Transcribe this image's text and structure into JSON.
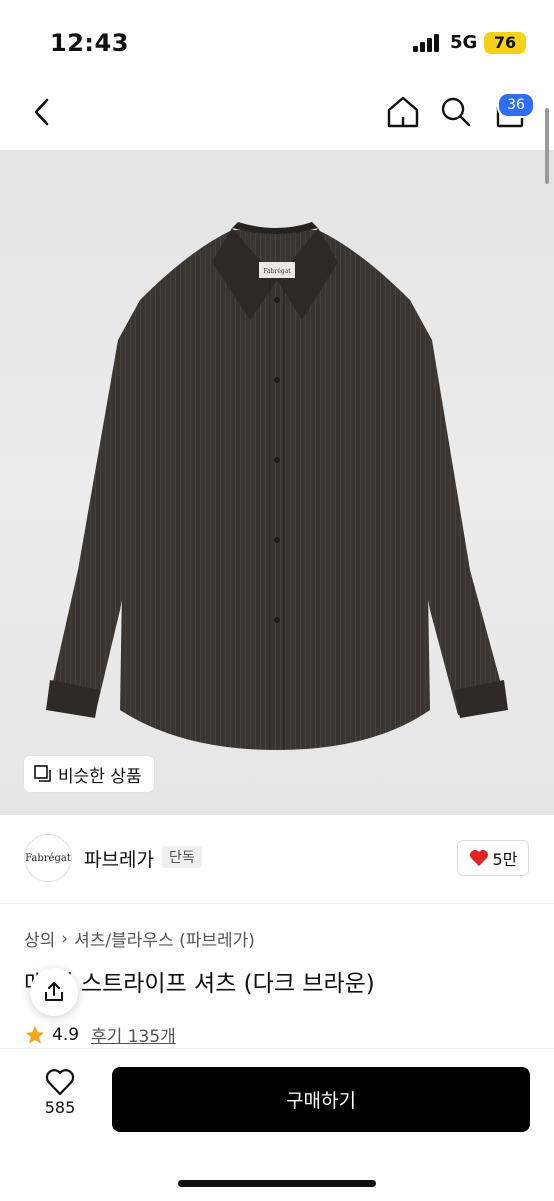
{
  "status_bar": {
    "time": "12:43",
    "network": "5G",
    "battery": "76"
  },
  "nav": {
    "cart_count": "36",
    "icons": [
      "back-icon",
      "home-icon",
      "search-icon",
      "bag-icon"
    ]
  },
  "image": {
    "similar_label": "비슷한 상품",
    "shirt_label_text": "Fabrégat"
  },
  "brand": {
    "logo_text": "Fabrégat",
    "name": "파브레가",
    "tag": "단독",
    "likes": "5만"
  },
  "breadcrumb": [
    "상의",
    "셔츠/블라우스 (파브레가)"
  ],
  "product": {
    "title": "매 시 스트라이프 셔츠 (다크 브라운)"
  },
  "rating": {
    "score": "4.9",
    "reviews": "후기 135개"
  },
  "bottom": {
    "wish_count": "585",
    "buy_label": "구매하기"
  },
  "colors": {
    "accent": "#2f6ef3",
    "battery": "#f5d11b",
    "heart": "#e02424",
    "star": "#f5a623",
    "shirt": "#3a3430"
  }
}
